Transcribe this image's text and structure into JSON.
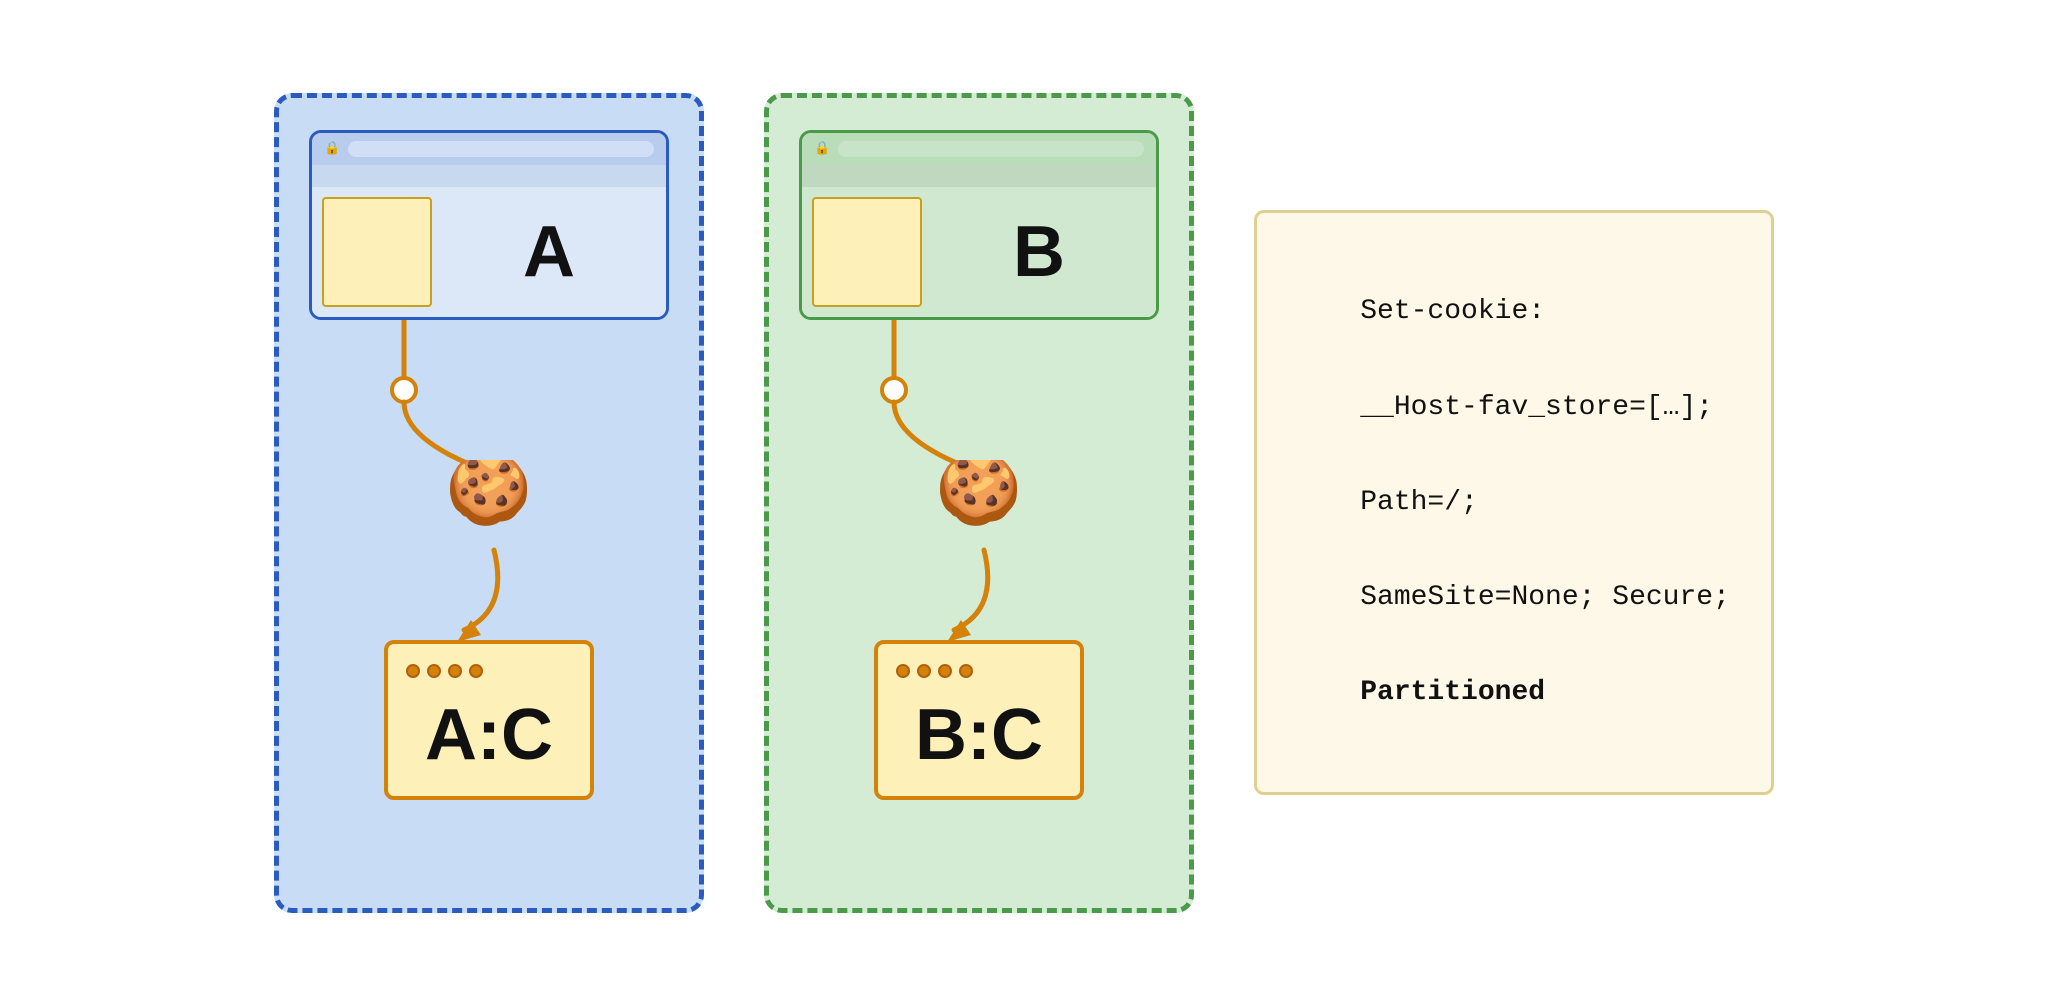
{
  "left_partition": {
    "label": "A",
    "color": "blue",
    "storage_label": "A:C"
  },
  "right_partition": {
    "label": "B",
    "color": "green",
    "storage_label": "B:C"
  },
  "code": {
    "line1": "Set-cookie:",
    "line2": "__Host-fav_store=[…];",
    "line3": "Path=/;",
    "line4": "SameSite=None; Secure;",
    "line5": "Partitioned"
  }
}
